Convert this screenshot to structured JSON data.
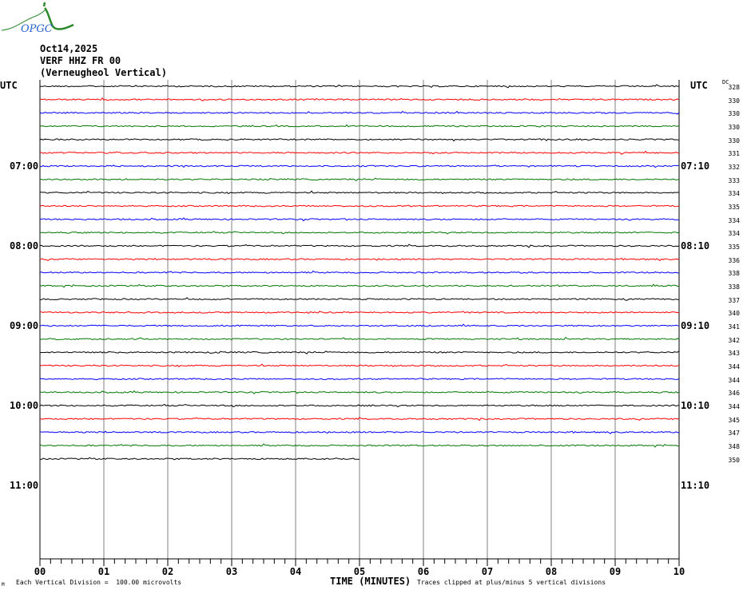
{
  "logo": {
    "text": "OPGC"
  },
  "header": {
    "date": "Oct14,2025",
    "station": "VERF HHZ FR 00",
    "name": "(Verneugheol Vertical)"
  },
  "axis": {
    "left_utc": "UTC",
    "right_utc": "UTC",
    "dc_label": "DC",
    "xlabel": "TIME (MINUTES)"
  },
  "footer": {
    "scale": "Each Vertical Division =  100.00 microvolts",
    "clip": "Traces clipped at plus/minus 5 vertical divisions",
    "corner": "M"
  },
  "colors": {
    "trace_cycle": [
      "#000000",
      "#ff0000",
      "#0000ff",
      "#007700"
    ],
    "grid": "#808080"
  },
  "chart_data": {
    "type": "line",
    "subtype": "helicorder",
    "minutes_per_line": 10,
    "x_ticks": [
      "00",
      "01",
      "02",
      "03",
      "04",
      "05",
      "06",
      "07",
      "08",
      "09",
      "10"
    ],
    "xlim": [
      0,
      10
    ],
    "left_hour_labels": [
      "07:00",
      "08:00",
      "09:00",
      "10:00",
      "11:00"
    ],
    "right_hour_labels": [
      "07:10",
      "08:10",
      "09:10",
      "10:10",
      "11:10"
    ],
    "dc_offsets": [
      "328",
      "330",
      "330",
      "330",
      "330",
      "331",
      "332",
      "333",
      "334",
      "335",
      "334",
      "334",
      "335",
      "336",
      "338",
      "338",
      "337",
      "340",
      "341",
      "342",
      "343",
      "344",
      "344",
      "346",
      "344",
      "345",
      "347",
      "348",
      "350"
    ],
    "last_line_end_minute": 5
  }
}
